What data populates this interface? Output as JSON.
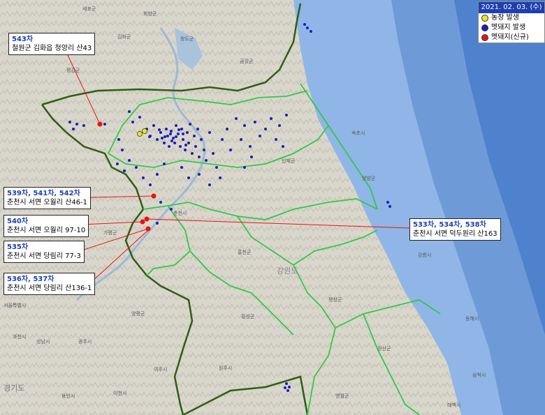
{
  "legend": {
    "date": "2021. 02. 03. (수)",
    "items": [
      {
        "label": "농장 발생",
        "color": "#f3e21a"
      },
      {
        "label": "멧돼지 발생",
        "color": "#1820b8"
      },
      {
        "label": "멧돼지(신규)",
        "color": "#e8140c"
      }
    ]
  },
  "callouts": [
    {
      "title": "543차",
      "address": "철원군 김화읍 청양리 산43"
    },
    {
      "title": "539차, 541차, 542차",
      "address": "춘천시 서면 오월리 산46-1"
    },
    {
      "title": "540차",
      "address": "춘천시 서면 오월리 97-10"
    },
    {
      "title": "535차",
      "address": "춘천시 서면 당림리 77-3"
    },
    {
      "title": "536차, 537차",
      "address": "춘천시 서면 당림리 산136-1"
    },
    {
      "title": "533차, 534차, 538차",
      "address": "춘천시 서면 덕두원리 산163"
    }
  ],
  "place_labels": [
    "세포군",
    "회양군",
    "김화군",
    "창도군",
    "평강군",
    "금강군",
    "속초시",
    "양양군",
    "인제군",
    "춘천시",
    "가평군",
    "홍천군",
    "강릉시",
    "서울특별시",
    "평창군",
    "횡성군",
    "양평군",
    "정선군",
    "동해시",
    "원주시",
    "영월군",
    "삼척시",
    "과천시",
    "성남시",
    "광주시",
    "이천시",
    "용인시",
    "여주시",
    "태백시",
    "경기도",
    "강원도"
  ]
}
